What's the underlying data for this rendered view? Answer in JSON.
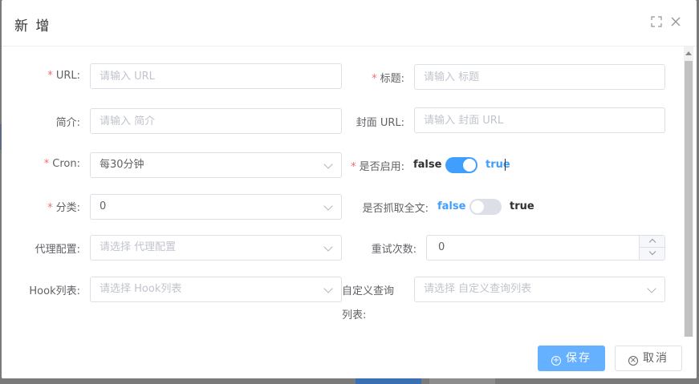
{
  "dialog": {
    "title": "新 增",
    "icons": [
      "fullscreen-icon",
      "close-icon"
    ]
  },
  "form": {
    "url": {
      "label": "URL:",
      "required": "*",
      "placeholder": "请输入 URL"
    },
    "title": {
      "label": "标题:",
      "required": "*",
      "placeholder": "请输入 标题"
    },
    "intro": {
      "label": "简介:",
      "placeholder": "请输入 简介"
    },
    "cover": {
      "label": "封面 URL:",
      "placeholder": "请输入 封面 URL"
    },
    "cron": {
      "label": "Cron:",
      "required": "*",
      "value": "每30分钟"
    },
    "enabled": {
      "label": "是否启用:",
      "required": "*",
      "off_text": "false",
      "on_text": "true",
      "state": true
    },
    "category": {
      "label": "分类:",
      "required": "*",
      "value": "0"
    },
    "fulltext": {
      "label": "是否抓取全文:",
      "off_text": "false",
      "on_text": "true",
      "state": false
    },
    "proxy": {
      "label": "代理配置:",
      "placeholder": "请选择 代理配置"
    },
    "retries": {
      "label": "重试次数:",
      "value": "0"
    },
    "hooks": {
      "label": "Hook列表:",
      "placeholder": "请选择 Hook列表"
    },
    "custom_query": {
      "label_line1": "自定义查询",
      "label_line2": "列表:",
      "placeholder": "请选择 自定义查询列表"
    }
  },
  "footer": {
    "save_label": "保存",
    "cancel_label": "取消"
  },
  "colors": {
    "primary": "#409eff",
    "primary_light": "#66b1ff",
    "required": "#f56c6c"
  }
}
